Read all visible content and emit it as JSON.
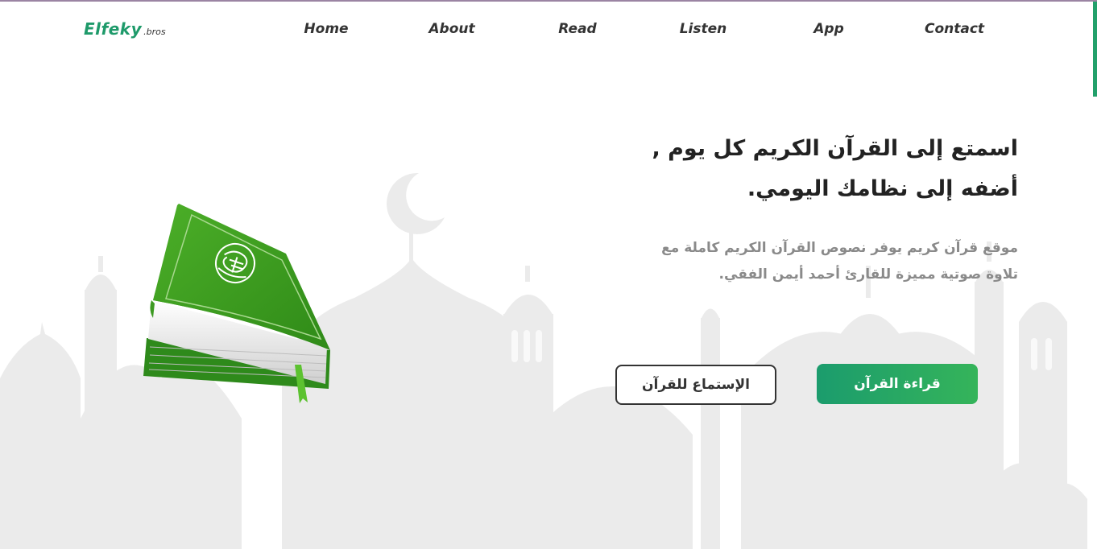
{
  "logo": {
    "main": "Elfeky",
    "sub": ".bros"
  },
  "nav": {
    "items": [
      {
        "label": "Home"
      },
      {
        "label": "About"
      },
      {
        "label": "Read"
      },
      {
        "label": "Listen"
      },
      {
        "label": "App"
      },
      {
        "label": "Contact"
      }
    ]
  },
  "hero": {
    "headline_line1": "اسمتع إلى القرآن الكريم كل يوم ,",
    "headline_line2": "أضفه إلى نظامك اليومي.",
    "description_line1": "موقع قرآن كريم يوفر نصوص القرآن الكريم كاملة مع",
    "description_line2": "تلاوة صوتية مميزة للقارئ أحمد أيمن الفقي.",
    "read_button": "قراءة القرآن",
    "listen_button": "الإستماع للقرآن"
  },
  "colors": {
    "accent": "#1e9a6a",
    "accent_light": "#35b45a",
    "text": "#333333",
    "muted": "#8a8a8a",
    "silhouette": "#ececec"
  },
  "icons": {
    "hero_image": "quran-book-icon",
    "background": "mosque-silhouette"
  }
}
